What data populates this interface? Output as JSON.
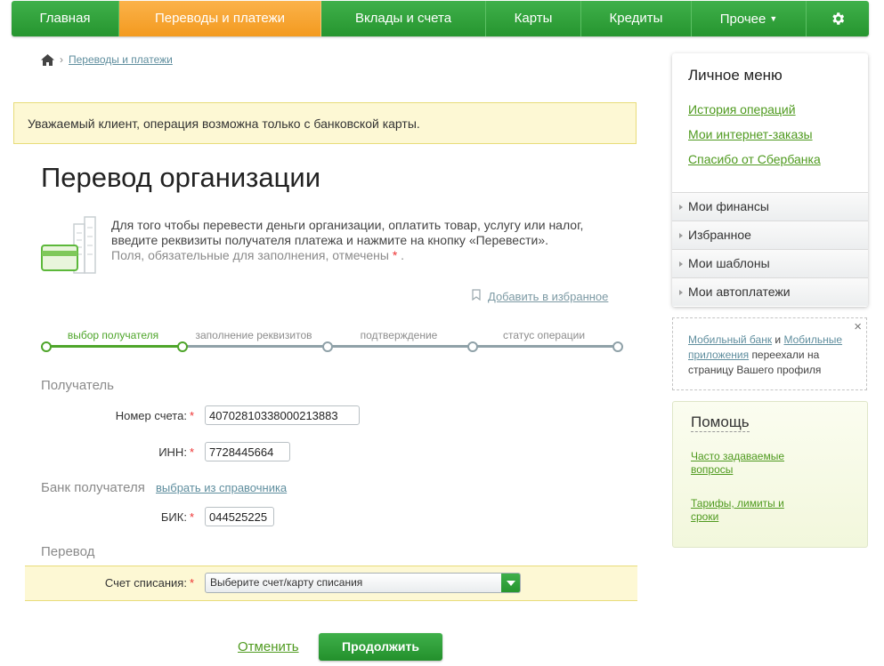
{
  "nav": {
    "items": [
      "Главная",
      "Переводы и платежи",
      "Вклады и счета",
      "Карты",
      "Кредиты",
      "Прочее"
    ],
    "active": "Переводы и платежи",
    "settings_icon": "gear-icon"
  },
  "breadcrumb": {
    "current": "Переводы и платежи"
  },
  "notice": "Уважаемый клиент, операция возможна только с банковской карты.",
  "page_title": "Перевод организации",
  "intro": {
    "text": "Для того чтобы перевести деньги организации, оплатить товар, услугу или налог, введите реквизиты получателя платежа и нажмите на кнопку «Перевести».",
    "required_note": "Поля, обязательные для заполнения, отмечены",
    "star": "*",
    "dot": "."
  },
  "favorite": "Добавить в избранное",
  "steps": [
    "выбор получателя",
    "заполнение реквизитов",
    "подтверждение",
    "статус операции"
  ],
  "form": {
    "recipient_section": "Получатель",
    "account_label": "Номер счета:",
    "account_value": "40702810338000213883",
    "inn_label": "ИНН:",
    "inn_value": "7728445664",
    "bank_section": "Банк получателя",
    "bank_choose_link": "выбрать из справочника",
    "bik_label": "БИК:",
    "bik_value": "044525225",
    "transfer_section": "Перевод",
    "debit_label": "Счет списания:",
    "debit_placeholder": "Выберите счет/карту списания",
    "star": "*"
  },
  "actions": {
    "cancel": "Отменить",
    "continue": "Продолжить"
  },
  "personal_menu": {
    "title": "Личное меню",
    "links": [
      "История операций",
      "Мои интернет-заказы",
      "Спасибо от Сбербанка"
    ],
    "rows": [
      "Мои финансы",
      "Избранное",
      "Мои шаблоны",
      "Мои автоплатежи"
    ]
  },
  "mobile_notice": {
    "link1": "Мобильный банк",
    "and": "и",
    "link2": "Мобильные приложения",
    "text": "переехали на страницу Вашего профиля",
    "close": "×"
  },
  "help": {
    "title": "Помощь",
    "links": [
      "Часто задаваемые вопросы",
      "Тарифы, лимиты и сроки"
    ]
  },
  "colors": {
    "green": "#2fa23a",
    "orange": "#f6a632",
    "notice_bg": "#fdf8d4"
  }
}
